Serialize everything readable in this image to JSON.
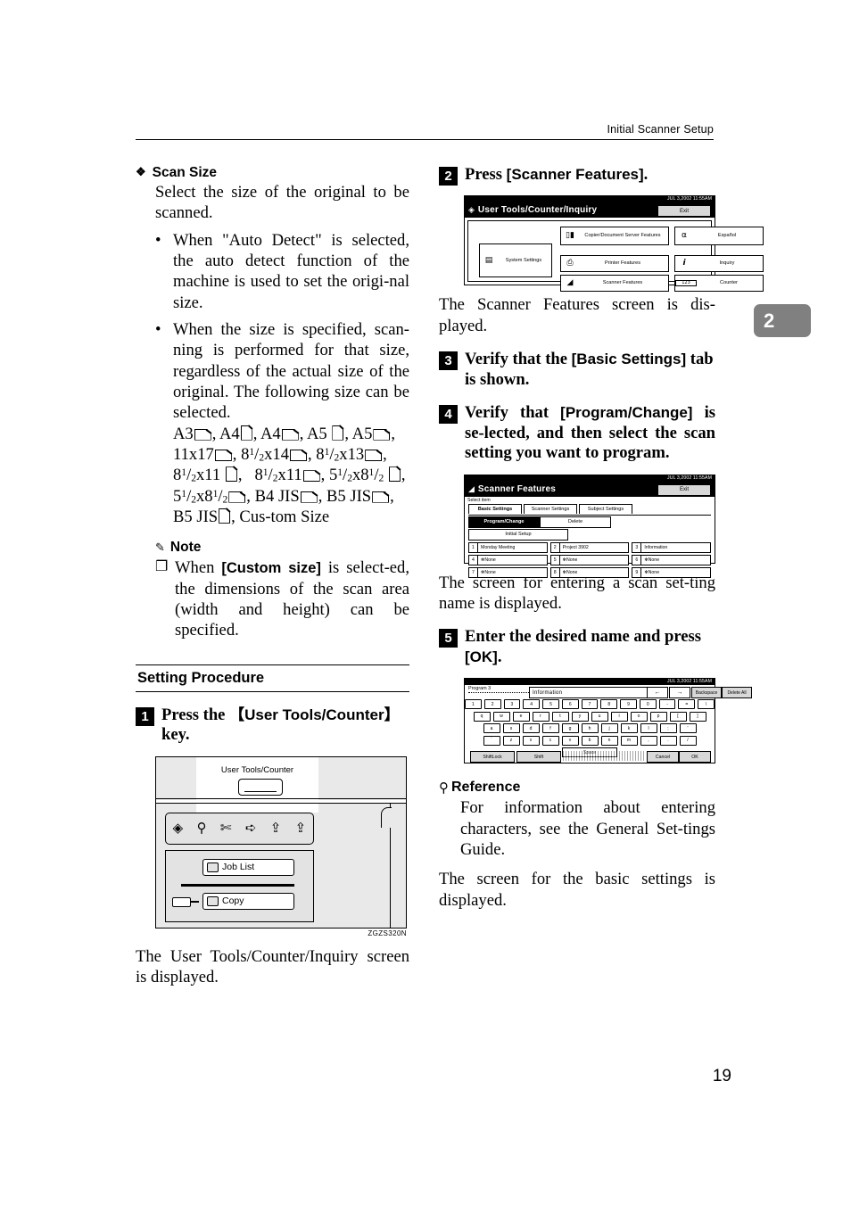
{
  "header": {
    "running_title": "Initial Scanner Setup"
  },
  "chapter_tab": "2",
  "page_number": "19",
  "left_column": {
    "scan_size": {
      "heading": "Scan Size",
      "diamond_glyph": "❖",
      "intro": "Select the size of the original to be scanned.",
      "bullet_dot": "•",
      "bullets": [
        "When \"Auto Detect\" is selected, the auto detect function of the machine is used to set the origi-nal size.",
        "When the size is specified, scan-ning is performed for that size, regardless of the actual size of the original. The following size can be selected."
      ],
      "size_list_plain": "A3L, A4P, A4L, A5P, A5L, 11x17L, 8 1/2x14L, 8 1/2x13L, 8 1/2x11P, 8 1/2x11L, 5 1/2x8 1/2P, 5 1/2x8 1/2L, B4 JISL, B5 JISL, B5 JISP, Custom Size"
    },
    "note": {
      "heading": "Note",
      "marker": "❐",
      "text_before": "When ",
      "ui_term": "[Custom size]",
      "text_after": " is select-ed, the dimensions of the scan area (width and height) can be specified."
    },
    "section_heading": "Setting Procedure",
    "step1": {
      "number": "1",
      "text_before": "Press the ",
      "ui_term": "【User Tools/Counter】",
      "text_after": " key."
    },
    "figure_panel": {
      "user_tools_label": "User Tools/Counter",
      "icons": [
        "data-in-icon",
        "wrench-icon",
        "scissors-icon",
        "eject-icon",
        "load-icon",
        "load-alt-icon"
      ],
      "icon_glyphs": [
        "◈",
        "⚲",
        "✂",
        "➪",
        "⇪",
        "⇫"
      ],
      "job_list_label": "Job List",
      "copy_label": "Copy",
      "figure_code": "ZGZS320N"
    },
    "after_step1": "The User Tools/Counter/Inquiry screen is displayed."
  },
  "right_column": {
    "step2": {
      "number": "2",
      "text_before": "Press ",
      "ui_term": "[Scanner Features]",
      "text_after": "."
    },
    "lcd_user_tools": {
      "status_date": "JUL  3,2002 11:55AM",
      "title": "User Tools/Counter/Inquiry",
      "title_icon": "◈",
      "exit_label": "Exit",
      "buttons": [
        {
          "id": "ut-sys",
          "label": "System Settings",
          "icon": "📋"
        },
        {
          "id": "ut-copy",
          "label": "Copier/Document Server Features",
          "icon": "▯▮"
        },
        {
          "id": "ut-print",
          "label": "Printer Features",
          "icon": "🖨"
        },
        {
          "id": "ut-scan",
          "label": "Scanner Features",
          "icon": "◢"
        },
        {
          "id": "ut-esp",
          "label": "Español",
          "icon": "🗚"
        },
        {
          "id": "ut-inq",
          "label": "Inquiry",
          "icon": "i"
        },
        {
          "id": "ut-cnt",
          "label": "Counter",
          "icon": "123"
        }
      ]
    },
    "after_step2": "The Scanner Features screen is dis-played.",
    "step3": {
      "number": "3",
      "text_before": "Verify that the ",
      "ui_term": "[Basic Settings]",
      "text_after": " tab is shown."
    },
    "step4": {
      "number": "4",
      "text_before": "Verify that ",
      "ui_term": "[Program/Change]",
      "text_after": " is se-lected, and then select the scan setting you want to program."
    },
    "lcd_scanner_features": {
      "status_date": "JUL  3,2002 11:55AM",
      "title": "Scanner Features",
      "title_icon": "◢",
      "exit_label": "Exit",
      "select_item": "Select item",
      "tabs": [
        "Basic Settings",
        "Scanner Settings",
        "Subject Settings"
      ],
      "active_tab": "Basic Settings",
      "mode_buttons": [
        "Program/Change",
        "Delete"
      ],
      "selected_mode": "Program/Change",
      "initial_setup": "Initial Setup",
      "entries": [
        {
          "n": "1",
          "v": "Monday Meeting"
        },
        {
          "n": "2",
          "v": "Project 3902"
        },
        {
          "n": "3",
          "v": "Information"
        },
        {
          "n": "4",
          "v": "✻None"
        },
        {
          "n": "5",
          "v": "✻None"
        },
        {
          "n": "6",
          "v": "✻None"
        },
        {
          "n": "7",
          "v": "✻None"
        },
        {
          "n": "8",
          "v": "✻None"
        },
        {
          "n": "9",
          "v": "✻None"
        }
      ]
    },
    "after_step4": "The screen for entering a scan set-ting name is displayed.",
    "step5": {
      "number": "5",
      "text_before": "Enter the desired name and press ",
      "ui_term": "[OK]",
      "text_after": "."
    },
    "lcd_keyboard": {
      "status_date": "JUL  3,2002 11:55AM",
      "program_label": "Program 3",
      "entered_text": "Information",
      "arrow_left": "←",
      "arrow_right": "→",
      "backspace_label": "Backspace",
      "delete_all_label": "Delete All",
      "rows": [
        [
          "1",
          "2",
          "3",
          "4",
          "5",
          "6",
          "7",
          "8",
          "9",
          "0",
          "-",
          "=",
          "\\"
        ],
        [
          "q",
          "w",
          "e",
          "r",
          "t",
          "y",
          "u",
          "i",
          "o",
          "p",
          "[",
          "]"
        ],
        [
          "a",
          "s",
          "d",
          "f",
          "g",
          "h",
          "j",
          "k",
          "l",
          ";",
          "'"
        ],
        [
          "`",
          "z",
          "x",
          "c",
          "v",
          "b",
          "n",
          "m",
          ",",
          ".",
          "/"
        ]
      ],
      "space_label": "Space",
      "shiftlock_label": "ShiftLock",
      "shift_label": "Shift",
      "cancel_label": "Cancel",
      "ok_label": "OK"
    },
    "reference": {
      "heading": "Reference",
      "icon": "🔎",
      "text": "For information about entering characters, see the General Set-tings Guide."
    },
    "after_step5": "The screen for the basic settings is displayed."
  }
}
